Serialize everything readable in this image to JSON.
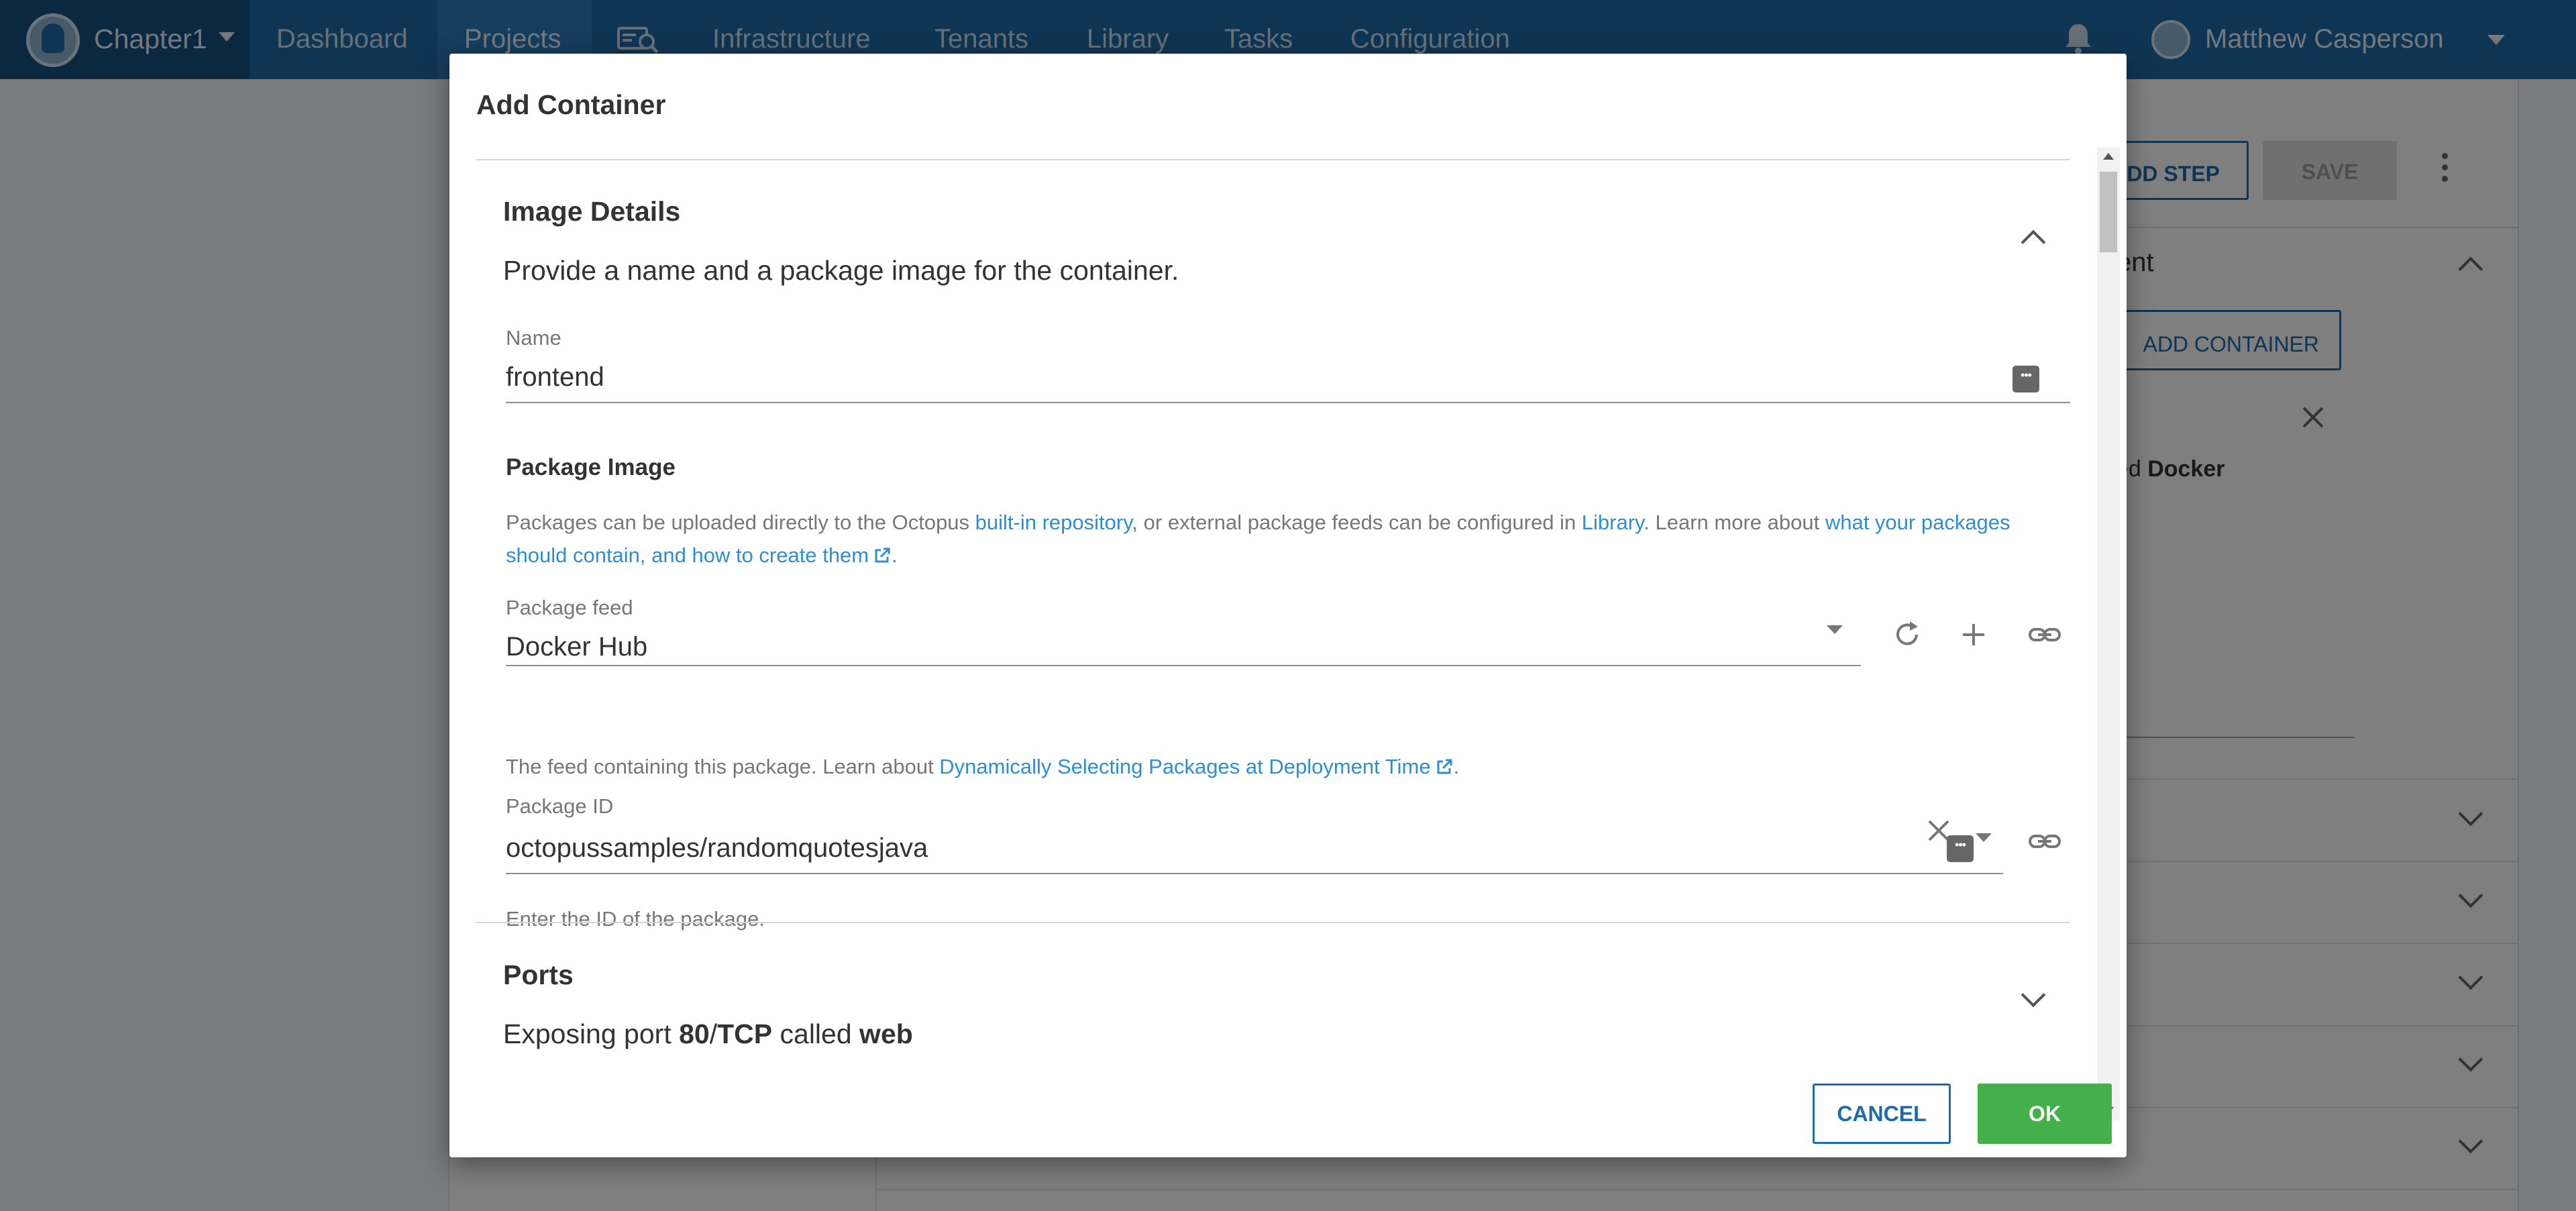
{
  "nav": {
    "space_name": "Chapter1",
    "items": [
      "Dashboard",
      "Projects",
      "Infrastructure",
      "Tenants",
      "Library",
      "Tasks",
      "Configuration"
    ],
    "active_item": "Projects",
    "user_name": "Matthew Casperson",
    "icons": [
      "space-avatar-icon",
      "search-machines-icon",
      "bell-icon",
      "user-avatar-icon",
      "chevron-down-icon"
    ]
  },
  "background": {
    "add_step_label": "ADD STEP",
    "save_label": "SAVE",
    "section_partial_title": "ent",
    "add_container_label": "ADD CONTAINER",
    "feed_text_prefix": "eed ",
    "feed_text_bold": "Docker"
  },
  "dialog": {
    "title": "Add Container",
    "image_details": {
      "title": "Image Details",
      "subtitle": "Provide a name and a package image for the container.",
      "name_label": "Name",
      "name_value": "frontend"
    },
    "package_image": {
      "title": "Package Image",
      "help_part1": "Packages can be uploaded directly to the Octopus ",
      "help_link1": "built-in repository",
      "help_part2": ", or external package feeds can be configured in ",
      "help_link2": "Library",
      "help_part3": ". Learn more about ",
      "help_link3": "what your packages should contain, and how to create them",
      "help_part4": ".",
      "feed_label": "Package feed",
      "feed_value": "Docker Hub",
      "feed_help_prefix": "The feed containing this package. Learn about ",
      "feed_help_link": "Dynamically Selecting Packages at Deployment Time",
      "feed_help_suffix": ".",
      "package_id_label": "Package ID",
      "package_id_value": "octopussamples/randomquotesjava",
      "package_id_help": "Enter the ID of the package."
    },
    "ports": {
      "title": "Ports",
      "summary_prefix": "Exposing port ",
      "summary_port": "80",
      "summary_sep": "/",
      "summary_protocol": "TCP",
      "summary_mid": " called ",
      "summary_name": "web"
    },
    "cancel_label": "CANCEL",
    "ok_label": "OK"
  },
  "colors": {
    "nav_bg": "#1f6aa8",
    "nav_space_bg": "#15507f",
    "link": "#2f8ed1",
    "ok_button": "#44b04a",
    "cancel_border": "#1f6aa8"
  }
}
